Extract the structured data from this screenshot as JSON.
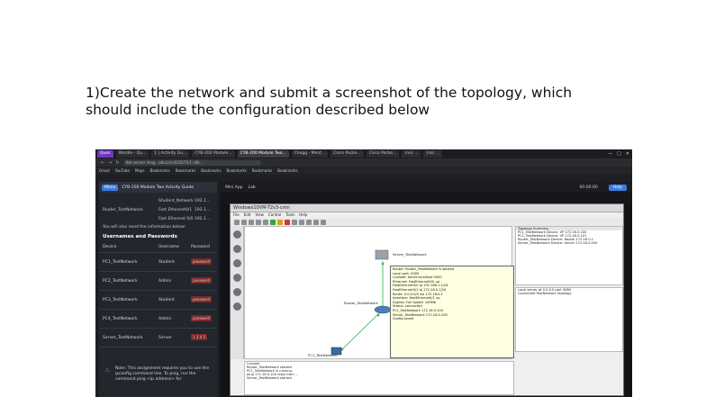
{
  "question": {
    "line1": "1)Create the network and submit a screenshot of the topology, which",
    "line2": "should include the configuration described below"
  },
  "browser": {
    "tabs": [
      {
        "label": "Ques",
        "style": "purple"
      },
      {
        "label": "Wordle - Qu...",
        "style": ""
      },
      {
        "label": "1 | Activity Gu...",
        "style": ""
      },
      {
        "label": "CYB-200 Module...",
        "style": ""
      },
      {
        "label": "CYB-200 Module Two...",
        "style": "active"
      },
      {
        "label": "Chegg - Ment...",
        "style": ""
      },
      {
        "label": "Cisco Packe...",
        "style": ""
      },
      {
        "label": "Cisco Packe...",
        "style": ""
      },
      {
        "label": "(no) ...",
        "style": ""
      },
      {
        "label": "(no) ...",
        "style": ""
      }
    ],
    "window_controls": [
      "—",
      "□",
      "✕"
    ],
    "url": "Not secure  imag...a6a1/c/c8/2D/T0/1-c8b...",
    "bookmarks": [
      "Gmail",
      "YouTube",
      "Maps",
      "Bookmarks",
      "Bookmarks",
      "Bookmarks",
      "Bookmarks",
      "Bookmarks",
      "Bookmarks"
    ]
  },
  "left_panel": {
    "menu_label": "Menu",
    "title": "CYB-200 Module Two Activity Guide",
    "top_rows": [
      {
        "a": "",
        "b": "Student_Network",
        "c": "192.1..."
      },
      {
        "a": "Router_TestNetwork",
        "b": "Fast Ethernet0/1",
        "c": "192.1..."
      },
      {
        "a": "",
        "b": "Fast Ethernet 0/0",
        "c": "192.1..."
      }
    ],
    "note": "You will also need the information below:",
    "heading": "Usernames and Passwords",
    "columns": [
      "Device",
      "Username",
      "Password"
    ],
    "rows": [
      {
        "device": "PC1_TestNetwork",
        "username": "Student",
        "password": "password"
      },
      {
        "device": "PC2_TestNetwork",
        "username": "Admin",
        "password": "password"
      },
      {
        "device": "PC3_TestNetwork",
        "username": "Student",
        "password": "password"
      },
      {
        "device": "PC4_TestNetwork",
        "username": "Admin",
        "password": "password"
      },
      {
        "device": "Server_TestNetwork",
        "username": "Server",
        "password": "1 3 4 5"
      }
    ],
    "warning": "Note: This assignment requires you to use the ipconfig command line. To ping, run the command ping <ip address> for"
  },
  "right_panel": {
    "tab1": "Mini App",
    "tab2": "Lab",
    "status": "00:00:00",
    "button": "Help",
    "vm_title": "Windows10VM-T2v3-cmn",
    "vm_menu": [
      "File",
      "Edit",
      "View",
      "Control",
      "Tools",
      "Help"
    ],
    "canvas_labels": {
      "server": "Server_TestNetwork",
      "router": "Router_TestNetwork",
      "pc": "PC1_TestNetwork"
    },
    "devices_title": "Topology Summary",
    "devices": [
      "PC1_TestNetwork  Device: VP  172.16.0.100",
      "PC2_TestNetwork  Device: VP  172.16.0.101",
      "Router_TestNetwork  Device: Router  172.16.0.1",
      "Server_TestNetwork  Device: Server  172.16.0.200"
    ],
    "servers": [
      "Local server  at  0.0.0.0  port  3080",
      "Connected  TestNetwork  Topology"
    ],
    "console_lines": [
      "Console",
      "Router_TestNetwork  started",
      "PC1_TestNetwork  is  running",
      "ping 172.16.0.100  reply from ...",
      "Server_TestNetwork  started"
    ],
    "popup_lines": [
      "Router: Router_TestNetwork is started",
      "Local port: 5000",
      "Console: telnet localhost 5000",
      "Ethernet: FastEthernet0/0 up",
      "FastEthernet0/0 ip 192.168.1.1/24",
      "FastEthernet0/1 ip 172.16.0.1/24",
      "Route: 0.0.0.0/0 via 172.16.0.1",
      "Interface: FastEthernet0/1 up",
      "Duplex: Full  Speed: 100Mb",
      "Status: connected",
      "PC1_TestNetwork 172.16.0.100",
      "Server_TestNetwork 172.16.0.200",
      "Config saved"
    ]
  }
}
